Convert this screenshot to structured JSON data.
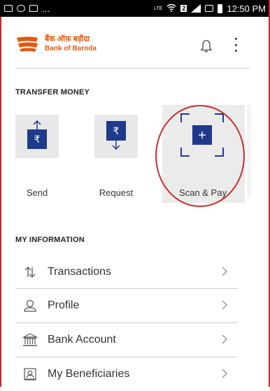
{
  "status_bar": {
    "left_dots": "...",
    "network": "LTE",
    "sim": "2",
    "time": "12:50 PM"
  },
  "brand": {
    "hindi": "बैंक ऑफ़ बड़ौदा",
    "english": "Bank of Baroda",
    "color": "#e05a12"
  },
  "sections": {
    "transfer_title": "TRANSFER MONEY",
    "info_title": "MY INFORMATION"
  },
  "transfer_actions": [
    {
      "label": "Send",
      "icon": "rupee-up-icon"
    },
    {
      "label": "Request",
      "icon": "rupee-down-icon"
    },
    {
      "label": "Scan & Pay",
      "icon": "scan-plus-icon"
    }
  ],
  "info_items": [
    {
      "label": "Transactions",
      "icon": "arrows-updown-icon"
    },
    {
      "label": "Profile",
      "icon": "person-icon"
    },
    {
      "label": "Bank Account",
      "icon": "bank-icon"
    },
    {
      "label": "My Beneficiaries",
      "icon": "beneficiaries-icon"
    }
  ],
  "colors": {
    "accent_navy": "#1f3a8a",
    "annotation_red": "#c4302b"
  }
}
